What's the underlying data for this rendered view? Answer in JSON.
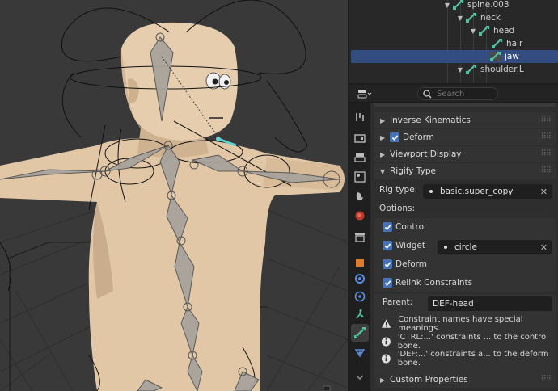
{
  "outliner": {
    "items": [
      {
        "label": "spine.003",
        "expanded": true
      },
      {
        "label": "neck",
        "expanded": true
      },
      {
        "label": "head",
        "expanded": true
      },
      {
        "label": "hair",
        "expanded": false
      },
      {
        "label": "jaw",
        "expanded": false,
        "selected": true
      },
      {
        "label": "shoulder.L",
        "expanded": true
      }
    ]
  },
  "header": {
    "search_placeholder": "Search"
  },
  "sections": {
    "inverse_kinematics": "Inverse Kinematics",
    "deform": "Deform",
    "viewport_display": "Viewport Display",
    "rigify_type": "Rigify Type",
    "custom_properties": "Custom Properties"
  },
  "rigify": {
    "rig_type_label": "Rig type:",
    "rig_type_value": "basic.super_copy",
    "options_label": "Options:",
    "control_label": "Control",
    "widget_label": "Widget",
    "widget_value": "circle",
    "deform_label": "Deform",
    "relink_label": "Relink Constraints",
    "parent_label": "Parent:",
    "parent_value": "DEF-head",
    "warning": "Constraint names have special meanings.",
    "info_ctrl": "'CTRL:...' constraints ... to the control bone.",
    "info_def": "'DEF:...' constraints a... to the deform bone."
  },
  "colors": {
    "accent": "#4772b3",
    "selected_row": "#334d80",
    "bone_icon": "#4fc3a1"
  }
}
